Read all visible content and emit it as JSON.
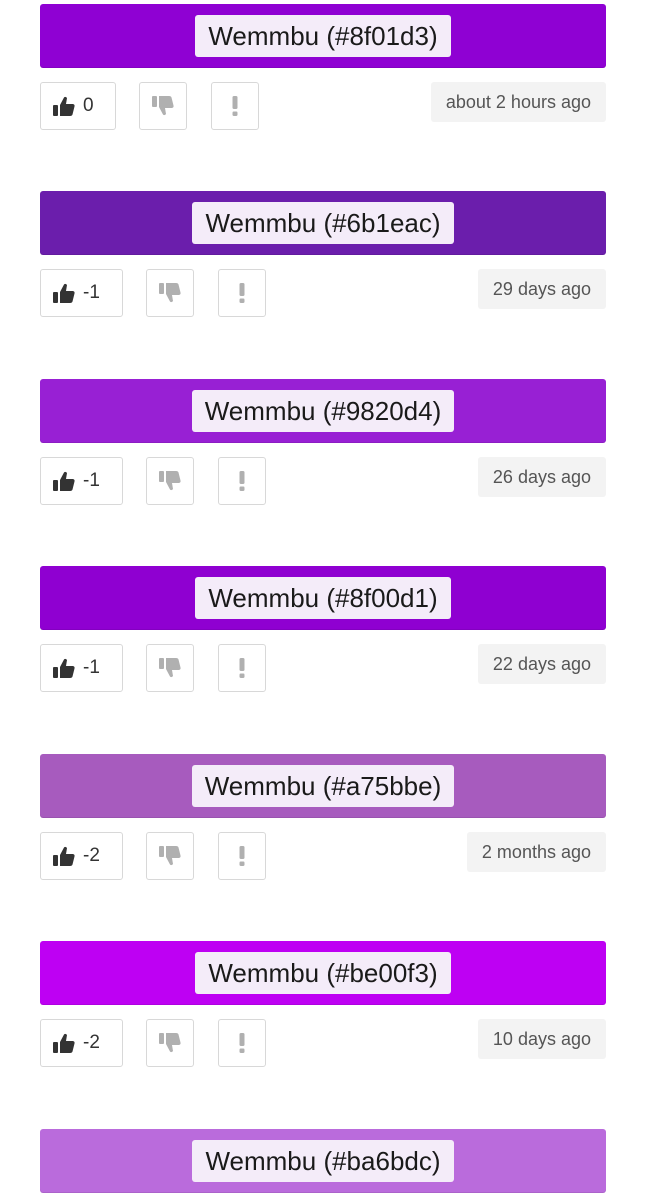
{
  "theme": {
    "label_background": "#f4ecf9",
    "time_background": "#f3f3f3",
    "button_border": "#d8d8d8",
    "up_icon_color": "#333333",
    "muted_icon_color": "#b0b0b0"
  },
  "entries": [
    {
      "title": "Wemmbu (#8f01d3)",
      "color": "#8f01d3",
      "votes": "0",
      "time": "about 2 hours ago",
      "up_icon": "thumbs-up-icon",
      "down_icon": "thumbs-down-icon",
      "flag_icon": "exclamation-icon"
    },
    {
      "title": "Wemmbu (#6b1eac)",
      "color": "#6b1eac",
      "votes": "-1",
      "time": "29 days ago",
      "up_icon": "thumbs-up-icon",
      "down_icon": "thumbs-down-icon",
      "flag_icon": "exclamation-icon"
    },
    {
      "title": "Wemmbu (#9820d4)",
      "color": "#9820d4",
      "votes": "-1",
      "time": "26 days ago",
      "up_icon": "thumbs-up-icon",
      "down_icon": "thumbs-down-icon",
      "flag_icon": "exclamation-icon"
    },
    {
      "title": "Wemmbu (#8f00d1)",
      "color": "#8f00d1",
      "votes": "-1",
      "time": "22 days ago",
      "up_icon": "thumbs-up-icon",
      "down_icon": "thumbs-down-icon",
      "flag_icon": "exclamation-icon"
    },
    {
      "title": "Wemmbu (#a75bbe)",
      "color": "#a75bbe",
      "votes": "-2",
      "time": "2 months ago",
      "up_icon": "thumbs-up-icon",
      "down_icon": "thumbs-down-icon",
      "flag_icon": "exclamation-icon"
    },
    {
      "title": "Wemmbu (#be00f3)",
      "color": "#be00f3",
      "votes": "-2",
      "time": "10 days ago",
      "up_icon": "thumbs-up-icon",
      "down_icon": "thumbs-down-icon",
      "flag_icon": "exclamation-icon"
    },
    {
      "title": "Wemmbu (#ba6bdc)",
      "color": "#ba6bdc",
      "votes": null,
      "time": null,
      "up_icon": null,
      "down_icon": null,
      "flag_icon": null
    }
  ]
}
